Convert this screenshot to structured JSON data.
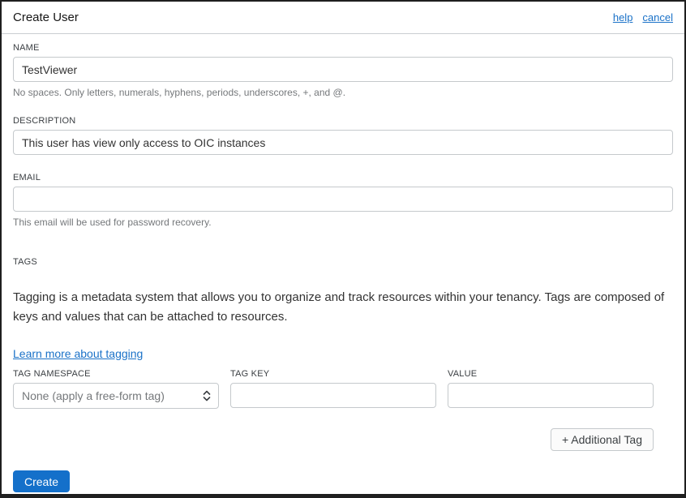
{
  "header": {
    "title": "Create User",
    "help_label": "help",
    "cancel_label": "cancel"
  },
  "fields": {
    "name": {
      "label": "NAME",
      "value": "TestViewer",
      "helper": "No spaces. Only letters, numerals, hyphens, periods, underscores, +, and @."
    },
    "description": {
      "label": "DESCRIPTION",
      "value": "This user has view only access to OIC instances"
    },
    "email": {
      "label": "EMAIL",
      "value": "",
      "helper": "This email will be used for password recovery."
    }
  },
  "tags": {
    "section_label": "TAGS",
    "description": "Tagging is a metadata system that allows you to organize and track resources within your tenancy. Tags are composed of keys and values that can be attached to resources.",
    "learn_more_label": "Learn more about tagging",
    "tag_namespace": {
      "label": "TAG NAMESPACE",
      "selected_option": "None (apply a free-form tag)"
    },
    "tag_key": {
      "label": "TAG KEY",
      "value": ""
    },
    "value": {
      "label": "VALUE",
      "value": ""
    },
    "additional_tag_label": "+ Additional Tag"
  },
  "actions": {
    "create_label": "Create"
  },
  "colors": {
    "accent_blue": "#1470ca",
    "link_blue": "#1b72c8",
    "border_gray": "#c5c9cc",
    "helper_gray": "#75787b"
  }
}
